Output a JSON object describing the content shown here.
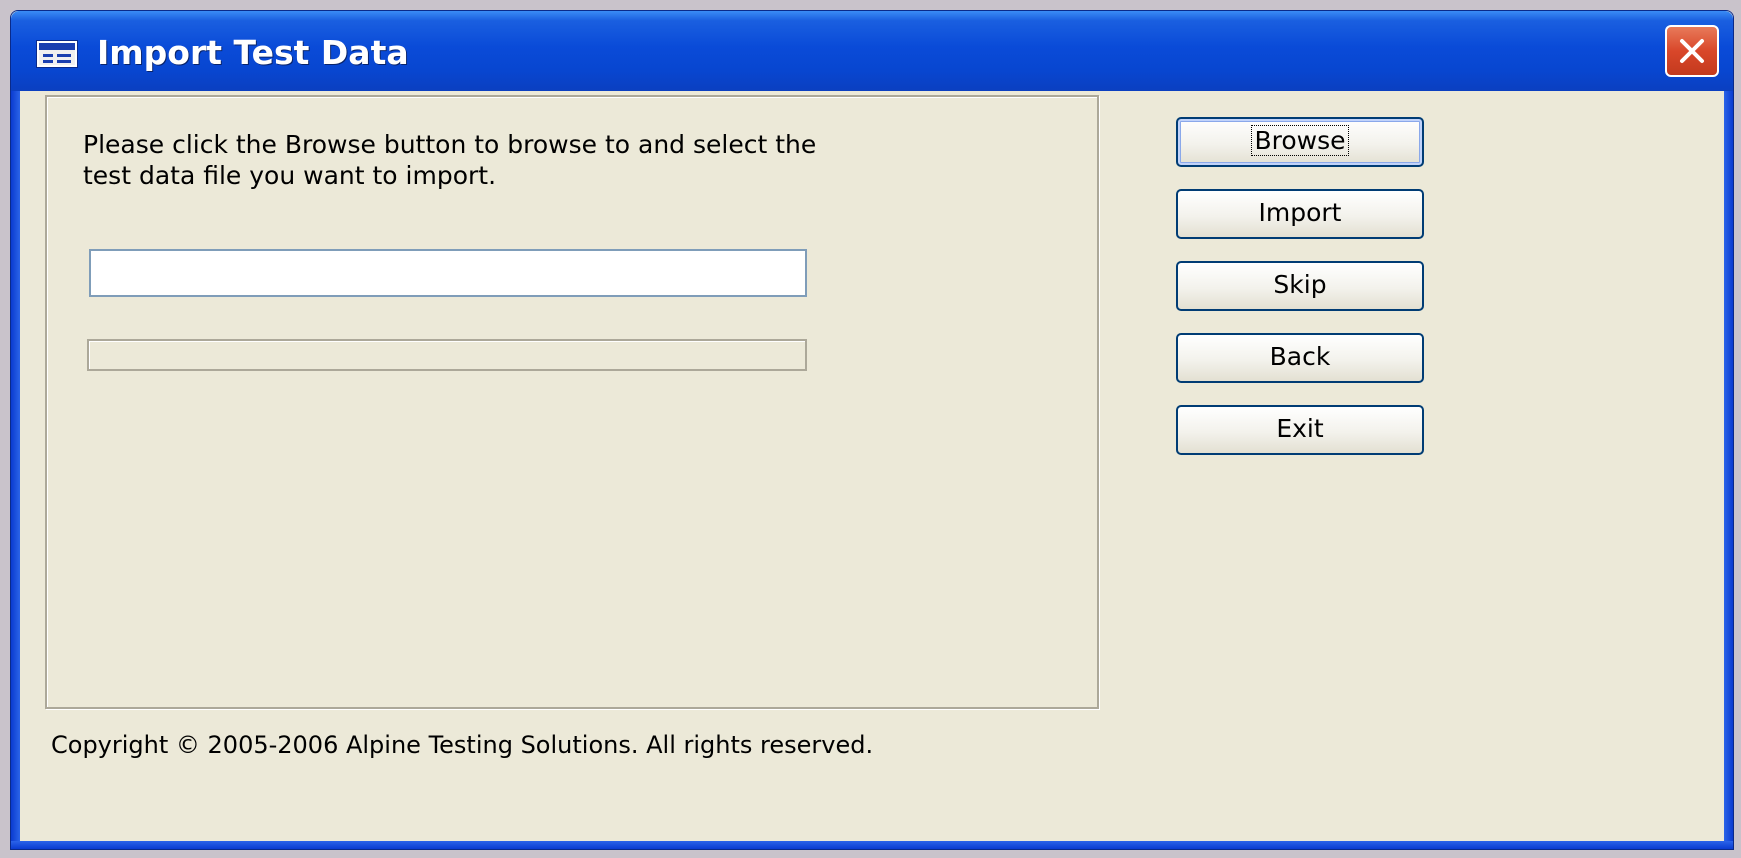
{
  "window": {
    "title": "Import Test Data",
    "close_label": "Close"
  },
  "main": {
    "instructions": "Please click the Browse button to browse to and select the test data file you want to import.",
    "file_path": {
      "value": "",
      "placeholder": ""
    },
    "progress_percent": 0
  },
  "buttons": {
    "browse": "Browse",
    "import": "Import",
    "skip": "Skip",
    "back": "Back",
    "exit": "Exit"
  },
  "footer": {
    "copyright": "Copyright © 2005-2006 Alpine Testing Solutions. All rights reserved."
  },
  "colors": {
    "titlebar": "#0a4bd8",
    "window_background": "#ece9d8",
    "close_button": "#d9472a",
    "button_border": "#003c74"
  },
  "icons": {
    "window": "form-window-icon",
    "close": "close-icon"
  }
}
